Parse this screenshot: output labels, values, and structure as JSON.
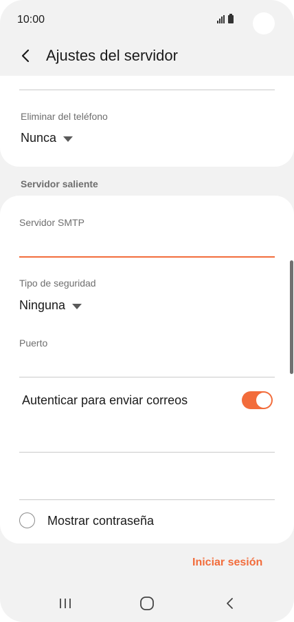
{
  "status_bar": {
    "time": "10:00",
    "icons": [
      "signal-icon",
      "battery-icon"
    ]
  },
  "header": {
    "title": "Ajustes del servidor",
    "back_icon": "chevron-left-icon"
  },
  "incoming": {
    "delete_label": "Eliminar del teléfono",
    "delete_value": "Nunca"
  },
  "outgoing": {
    "section_title": "Servidor saliente",
    "smtp_label": "Servidor SMTP",
    "smtp_value": "",
    "security_label": "Tipo de seguridad",
    "security_value": "Ninguna",
    "port_label": "Puerto",
    "port_value": "",
    "auth_label": "Autenticar para enviar correos",
    "auth_enabled": true,
    "username_value": "",
    "password_value": "",
    "show_password_label": "Mostrar contraseña",
    "show_password_checked": false
  },
  "actions": {
    "signin_label": "Iniciar sesión"
  },
  "nav_bar": {
    "recent_icon": "recent-apps-icon",
    "home_icon": "home-icon",
    "back_icon": "back-icon"
  },
  "colors": {
    "accent": "#f26c3b",
    "background": "#f2f2f2",
    "card": "#ffffff",
    "text_primary": "#1a1a1a",
    "text_secondary": "#6e6e6e"
  }
}
